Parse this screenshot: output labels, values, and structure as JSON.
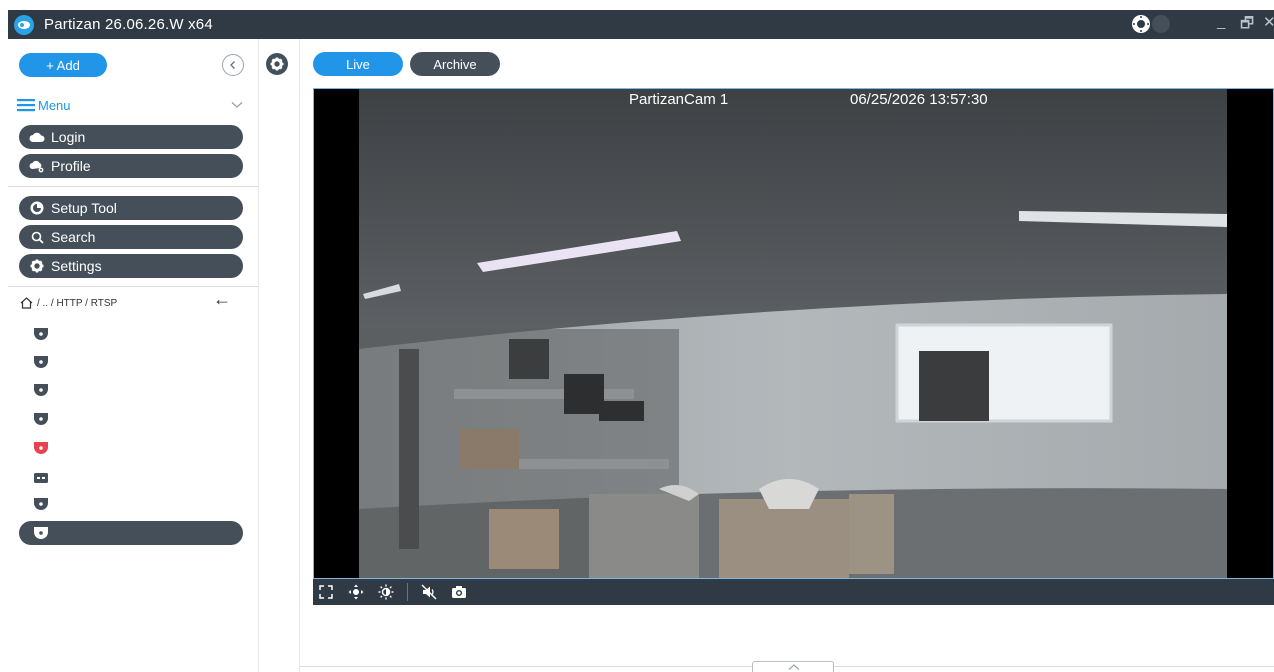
{
  "window": {
    "title": "Partizan   26.06.26.W  x64",
    "minimize": "_",
    "restore": "🗗",
    "close": "✕"
  },
  "sidebar": {
    "add_label": "+  Add",
    "menu_label": "Menu",
    "login_label": "Login",
    "profile_label": "Profile",
    "setup_tool_label": "Setup Tool",
    "search_label": "Search",
    "settings_label": "Settings",
    "breadcrumb": "/ .. / HTTP / RTSP",
    "back_arrow": "←",
    "devices": [
      {
        "icon": "dome-camera-icon",
        "color": "#454f59"
      },
      {
        "icon": "dome-camera-icon",
        "color": "#454f59"
      },
      {
        "icon": "dome-camera-icon",
        "color": "#454f59"
      },
      {
        "icon": "dome-camera-icon",
        "color": "#454f59"
      },
      {
        "icon": "dome-camera-icon",
        "color": "#e8434f"
      },
      {
        "icon": "recorder-icon",
        "color": "#454f59"
      },
      {
        "icon": "dome-camera-icon",
        "color": "#454f59"
      }
    ]
  },
  "main": {
    "tab_live": "Live",
    "tab_archive": "Archive",
    "video": {
      "camera_name": "PartizanCam 1",
      "timestamp": "06/25/2026 13:57:30"
    }
  },
  "colors": {
    "titlebar": "#2f3a45",
    "accent": "#2196e8",
    "pill_dark": "#454f59",
    "alert": "#e8434f"
  }
}
